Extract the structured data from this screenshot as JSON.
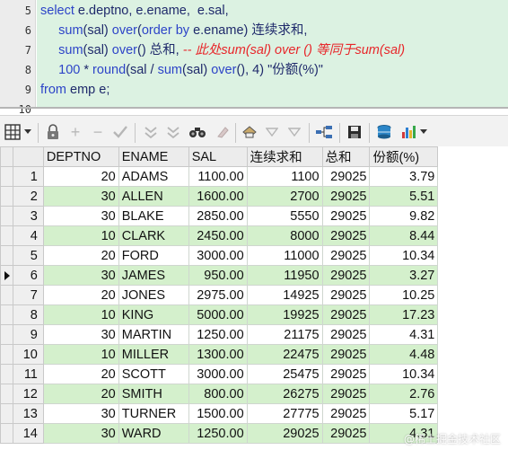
{
  "editor": {
    "line_numbers": [
      "5",
      "6",
      "7",
      "8",
      "9",
      "10"
    ],
    "lines": [
      {
        "number": "5",
        "segments": [
          {
            "cls": "kw",
            "text": "select "
          },
          {
            "cls": "tx",
            "text": "e.deptno, e.ename,  e.sal,"
          }
        ]
      },
      {
        "number": "6",
        "segments": [
          {
            "cls": "kw",
            "text": "     sum"
          },
          {
            "cls": "tx",
            "text": "(sal) "
          },
          {
            "cls": "kw",
            "text": "over"
          },
          {
            "cls": "tx",
            "text": "("
          },
          {
            "cls": "kw",
            "text": "order by "
          },
          {
            "cls": "tx",
            "text": "e.ename) 连续求和,"
          }
        ]
      },
      {
        "number": "7",
        "segments": [
          {
            "cls": "kw",
            "text": "     sum"
          },
          {
            "cls": "tx",
            "text": "(sal) "
          },
          {
            "cls": "kw",
            "text": "over"
          },
          {
            "cls": "tx",
            "text": "() 总和, "
          },
          {
            "cls": "cm",
            "text": "-- 此处sum(sal) over () 等同于sum(sal)"
          }
        ]
      },
      {
        "number": "8",
        "segments": [
          {
            "cls": "kw",
            "text": "     100 "
          },
          {
            "cls": "tx",
            "text": "* "
          },
          {
            "cls": "kw",
            "text": "round"
          },
          {
            "cls": "tx",
            "text": "(sal / "
          },
          {
            "cls": "kw",
            "text": "sum"
          },
          {
            "cls": "tx",
            "text": "(sal) "
          },
          {
            "cls": "kw",
            "text": "over"
          },
          {
            "cls": "tx",
            "text": "(), 4) \"份额(%)\""
          }
        ]
      },
      {
        "number": "9",
        "segments": [
          {
            "cls": "kw",
            "text": "from "
          },
          {
            "cls": "tx",
            "text": "emp e;"
          }
        ]
      },
      {
        "number": "10",
        "segments": []
      }
    ]
  },
  "toolbar": {
    "icons": [
      "grid-view-icon",
      "dropdown-arrow-icon",
      "lock-icon",
      "add-row-icon",
      "delete-row-icon",
      "post-changes-icon",
      "query-by-example-icon",
      "clear-filter-icon",
      "find-icon",
      "clear-icon",
      "print-icon",
      "next-page-icon",
      "last-page-icon",
      "export-icon",
      "save-icon",
      "database-icon",
      "chart-icon"
    ]
  },
  "grid": {
    "columns": [
      "DEPTNO",
      "ENAME",
      "SAL",
      "连续求和",
      "总和",
      "份额(%)"
    ],
    "current_row": 6,
    "rows": [
      {
        "n": "1",
        "deptno": "20",
        "ename": "ADAMS",
        "sal": "1100.00",
        "cum": "1100",
        "total": "29025",
        "share": "3.79"
      },
      {
        "n": "2",
        "deptno": "30",
        "ename": "ALLEN",
        "sal": "1600.00",
        "cum": "2700",
        "total": "29025",
        "share": "5.51"
      },
      {
        "n": "3",
        "deptno": "30",
        "ename": "BLAKE",
        "sal": "2850.00",
        "cum": "5550",
        "total": "29025",
        "share": "9.82"
      },
      {
        "n": "4",
        "deptno": "10",
        "ename": "CLARK",
        "sal": "2450.00",
        "cum": "8000",
        "total": "29025",
        "share": "8.44"
      },
      {
        "n": "5",
        "deptno": "20",
        "ename": "FORD",
        "sal": "3000.00",
        "cum": "11000",
        "total": "29025",
        "share": "10.34"
      },
      {
        "n": "6",
        "deptno": "30",
        "ename": "JAMES",
        "sal": "950.00",
        "cum": "11950",
        "total": "29025",
        "share": "3.27"
      },
      {
        "n": "7",
        "deptno": "20",
        "ename": "JONES",
        "sal": "2975.00",
        "cum": "14925",
        "total": "29025",
        "share": "10.25"
      },
      {
        "n": "8",
        "deptno": "10",
        "ename": "KING",
        "sal": "5000.00",
        "cum": "19925",
        "total": "29025",
        "share": "17.23"
      },
      {
        "n": "9",
        "deptno": "30",
        "ename": "MARTIN",
        "sal": "1250.00",
        "cum": "21175",
        "total": "29025",
        "share": "4.31"
      },
      {
        "n": "10",
        "deptno": "10",
        "ename": "MILLER",
        "sal": "1300.00",
        "cum": "22475",
        "total": "29025",
        "share": "4.48"
      },
      {
        "n": "11",
        "deptno": "20",
        "ename": "SCOTT",
        "sal": "3000.00",
        "cum": "25475",
        "total": "29025",
        "share": "10.34"
      },
      {
        "n": "12",
        "deptno": "20",
        "ename": "SMITH",
        "sal": "800.00",
        "cum": "26275",
        "total": "29025",
        "share": "2.76"
      },
      {
        "n": "13",
        "deptno": "30",
        "ename": "TURNER",
        "sal": "1500.00",
        "cum": "27775",
        "total": "29025",
        "share": "5.17"
      },
      {
        "n": "14",
        "deptno": "30",
        "ename": "WARD",
        "sal": "1250.00",
        "cum": "29025",
        "total": "29025",
        "share": "4.31"
      }
    ]
  },
  "watermark": "@稀土掘金技术社区",
  "colors": {
    "keyword": "#2d44c8",
    "identifier": "#1f2a6b",
    "comment": "#e8262a",
    "editor_bg": "#dcf2e2",
    "row_alt": "#d4f0cc"
  }
}
